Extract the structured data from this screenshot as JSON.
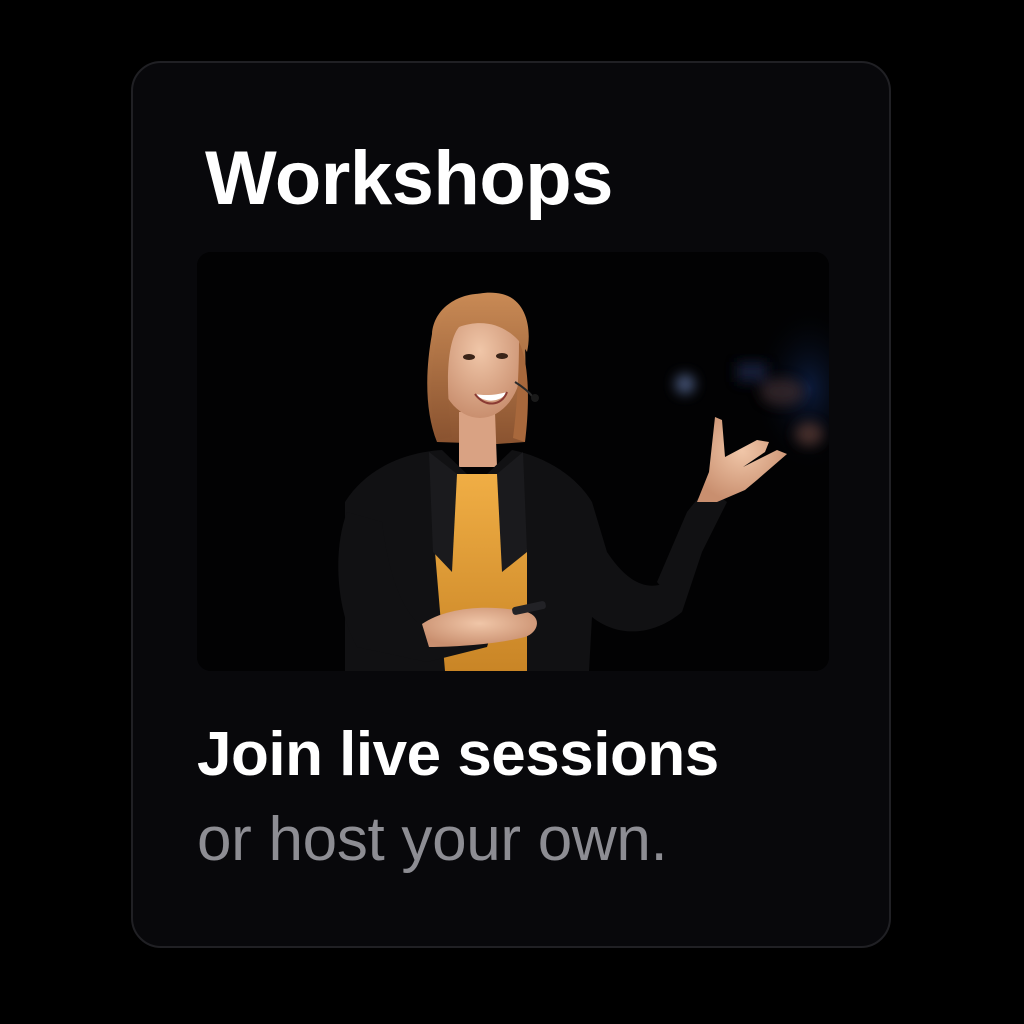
{
  "card": {
    "title": "Workshops",
    "headline": "Join live sessions",
    "subline": "or host your own."
  },
  "colors": {
    "background": "#000000",
    "card": "#08080b",
    "title": "#ffffff",
    "subline": "#8d8d93",
    "accent_shirt": "#e8a43a"
  }
}
